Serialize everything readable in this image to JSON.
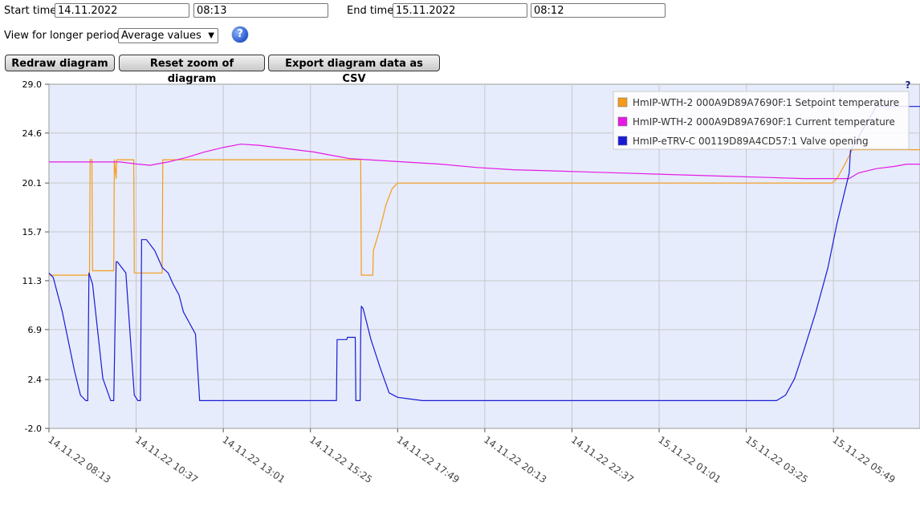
{
  "controls": {
    "start_label": "Start time",
    "start_date": "14.11.2022",
    "start_time": "08:13",
    "end_label": "End time",
    "end_date": "15.11.2022",
    "end_time": "08:12",
    "period_label": "View for longer periods",
    "period_value": "Average values",
    "help_icon": "help-icon",
    "help_glyph": "?",
    "redraw_button": "Redraw diagram",
    "reset_zoom_button": "Reset zoom of diagram",
    "export_button": "Export diagram data as CSV"
  },
  "chart_corner_glyph": "?",
  "chart_data": {
    "type": "line",
    "title": "",
    "xlabel": "",
    "ylabel": "",
    "ylim": [
      -2.0,
      29.0
    ],
    "y_ticks": [
      "29.0",
      "24.6",
      "20.1",
      "15.7",
      "11.3",
      "6.9",
      "2.4",
      "-2.0"
    ],
    "x_range": [
      "14.11.22 08:13",
      "15.11.22 08:12"
    ],
    "x_ticks": [
      "14.11.22 08:13",
      "14.11.22 10:37",
      "14.11.22 13:01",
      "14.11.22 15:25",
      "14.11.22 17:49",
      "14.11.22 20:13",
      "14.11.22 22:37",
      "15.11.22 01:01",
      "15.11.22 03:25",
      "15.11.22 05:49"
    ],
    "grid": true,
    "legend_position": "top-right",
    "colors": {
      "plot_bg": "#e6ecfb",
      "grid": "#c8c8c8",
      "setpoint": "#f59b1a",
      "current": "#e619e6",
      "valve": "#1a1ad6"
    },
    "series": [
      {
        "name": "HmIP-WTH-2 000A9D89A7690F:1 Setpoint temperature",
        "color_key": "setpoint",
        "x": [
          "14.11.22 08:13",
          "14.11.22 09:20",
          "14.11.22 09:21",
          "14.11.22 09:24",
          "14.11.22 09:25",
          "14.11.22 10:00",
          "14.11.22 10:01",
          "14.11.22 10:04",
          "14.11.22 10:05",
          "14.11.22 10:33",
          "14.11.22 10:34",
          "14.11.22 11:20",
          "14.11.22 11:21",
          "14.11.22 12:00",
          "14.11.22 13:00",
          "14.11.22 14:00",
          "14.11.22 15:00",
          "14.11.22 16:00",
          "14.11.22 16:48",
          "14.11.22 16:49",
          "14.11.22 17:08",
          "14.11.22 17:09",
          "14.11.22 17:20",
          "14.11.22 17:30",
          "14.11.22 17:40",
          "14.11.22 17:49",
          "14.11.22 18:00",
          "14.11.22 20:00",
          "14.11.22 22:00",
          "15.11.22 00:00",
          "15.11.22 02:00",
          "15.11.22 04:00",
          "15.11.22 05:00",
          "15.11.22 05:47",
          "15.11.22 05:55",
          "15.11.22 06:10",
          "15.11.22 06:20",
          "15.11.22 06:30",
          "15.11.22 08:12"
        ],
        "values": [
          11.8,
          11.8,
          22.2,
          22.2,
          12.2,
          12.2,
          22.2,
          20.5,
          22.2,
          22.2,
          12.0,
          12.0,
          22.2,
          22.2,
          22.2,
          22.2,
          22.2,
          22.2,
          22.2,
          11.8,
          11.8,
          14.0,
          16.0,
          18.2,
          19.6,
          20.1,
          20.1,
          20.1,
          20.1,
          20.1,
          20.1,
          20.1,
          20.1,
          20.1,
          20.5,
          22.0,
          23.1,
          23.1,
          23.1
        ]
      },
      {
        "name": "HmIP-WTH-2 000A9D89A7690F:1 Current temperature",
        "color_key": "current",
        "x": [
          "14.11.22 08:13",
          "14.11.22 09:10",
          "14.11.22 09:50",
          "14.11.22 10:10",
          "14.11.22 10:40",
          "14.11.22 11:00",
          "14.11.22 11:30",
          "14.11.22 12:00",
          "14.11.22 12:30",
          "14.11.22 13:00",
          "14.11.22 13:30",
          "14.11.22 14:00",
          "14.11.22 14:30",
          "14.11.22 15:00",
          "14.11.22 15:30",
          "14.11.22 16:00",
          "14.11.22 16:30",
          "14.11.22 17:00",
          "14.11.22 18:00",
          "14.11.22 19:00",
          "14.11.22 20:00",
          "14.11.22 21:00",
          "14.11.22 22:00",
          "14.11.22 23:00",
          "15.11.22 00:00",
          "15.11.22 01:00",
          "15.11.22 02:00",
          "15.11.22 03:00",
          "15.11.22 04:00",
          "15.11.22 05:00",
          "15.11.22 05:30",
          "15.11.22 06:15",
          "15.11.22 06:30",
          "15.11.22 07:00",
          "15.11.22 07:30",
          "15.11.22 07:50",
          "15.11.22 08:12"
        ],
        "values": [
          22.0,
          22.0,
          22.0,
          22.0,
          21.8,
          21.7,
          22.0,
          22.4,
          22.9,
          23.3,
          23.6,
          23.5,
          23.3,
          23.1,
          22.9,
          22.6,
          22.3,
          22.2,
          22.0,
          21.8,
          21.5,
          21.3,
          21.2,
          21.1,
          21.0,
          20.9,
          20.8,
          20.7,
          20.6,
          20.5,
          20.5,
          20.5,
          21.0,
          21.4,
          21.6,
          21.8,
          21.8
        ]
      },
      {
        "name": "HmIP-eTRV-C 00119D89A4CD57:1 Valve opening",
        "color_key": "valve",
        "x": [
          "14.11.22 08:13",
          "14.11.22 08:20",
          "14.11.22 08:35",
          "14.11.22 08:55",
          "14.11.22 09:05",
          "14.11.22 09:14",
          "14.11.22 09:17",
          "14.11.22 09:19",
          "14.11.22 09:25",
          "14.11.22 09:42",
          "14.11.22 09:55",
          "14.11.22 10:00",
          "14.11.22 10:04",
          "14.11.22 10:06",
          "14.11.22 10:20",
          "14.11.22 10:34",
          "14.11.22 10:40",
          "14.11.22 10:44",
          "14.11.22 10:46",
          "14.11.22 10:54",
          "14.11.22 11:08",
          "14.11.22 11:20",
          "14.11.22 11:30",
          "14.11.22 11:38",
          "14.11.22 11:48",
          "14.11.22 11:55",
          "14.11.22 12:05",
          "14.11.22 12:15",
          "14.11.22 12:22",
          "14.11.22 12:30",
          "14.11.22 12:38",
          "14.11.22 12:45",
          "14.11.22 12:51",
          "14.11.22 12:56",
          "14.11.22 13:01",
          "14.11.22 13:05",
          "14.11.22 14:00",
          "14.11.22 15:00",
          "14.11.22 16:08",
          "14.11.22 16:09",
          "14.11.22 16:25",
          "14.11.22 16:26",
          "14.11.22 16:39",
          "14.11.22 16:40",
          "14.11.22 16:47",
          "14.11.22 16:48",
          "14.11.22 16:49",
          "14.11.22 16:52",
          "14.11.22 17:05",
          "14.11.22 17:20",
          "14.11.22 17:35",
          "14.11.22 17:49",
          "14.11.22 18:30",
          "14.11.22 19:00",
          "14.11.22 20:00",
          "14.11.22 22:00",
          "15.11.22 00:00",
          "15.11.22 02:00",
          "15.11.22 04:00",
          "15.11.22 04:15",
          "15.11.22 04:30",
          "15.11.22 04:45",
          "15.11.22 05:00",
          "15.11.22 05:20",
          "15.11.22 05:40",
          "15.11.22 05:55",
          "15.11.22 06:15",
          "15.11.22 06:17",
          "15.11.22 07:00",
          "15.11.22 07:50",
          "15.11.22 07:51",
          "15.11.22 08:12"
        ],
        "values": [
          12.0,
          11.6,
          8.5,
          3.2,
          1.0,
          0.5,
          0.5,
          12.0,
          11.0,
          2.5,
          0.5,
          0.5,
          13.0,
          13.0,
          12.0,
          1.0,
          0.5,
          0.5,
          15.0,
          15.0,
          14.0,
          12.5,
          12.0,
          11.0,
          10.0,
          8.5,
          7.5,
          6.5,
          0.5,
          0.5,
          0.5,
          0.5,
          0.5,
          0.5,
          0.5,
          0.5,
          0.5,
          0.5,
          0.5,
          6.0,
          6.0,
          6.2,
          6.2,
          0.5,
          0.5,
          6.5,
          9.0,
          8.8,
          6.0,
          3.5,
          1.2,
          0.8,
          0.5,
          0.5,
          0.5,
          0.5,
          0.5,
          0.5,
          0.5,
          0.5,
          1.0,
          2.5,
          5.0,
          8.5,
          12.5,
          16.5,
          21.0,
          23.0,
          27.0,
          27.0,
          27.0,
          27.0
        ]
      }
    ]
  }
}
